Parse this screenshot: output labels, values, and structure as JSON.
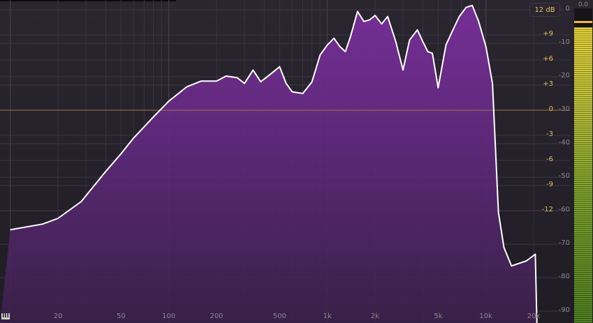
{
  "range_button": "12 dB",
  "meter": {
    "readout": "0.0",
    "level": 0.94,
    "peak": 0.96
  },
  "eq_scale": [
    "+9",
    "+6",
    "+3",
    "0",
    "-3",
    "-6",
    "-9",
    "-12"
  ],
  "db_scale": [
    "0",
    "-10",
    "-20",
    "-30",
    "-40",
    "-50",
    "-60",
    "-70",
    "-80",
    "-90"
  ],
  "freq_scale": [
    "20",
    "50",
    "100",
    "200",
    "500",
    "1k",
    "2k",
    "5k",
    "10k",
    "20k"
  ],
  "icons": {
    "piano": "piano-keys-icon"
  },
  "colors": {
    "curve": "#ffffff",
    "fill": "#6a2a88",
    "eq_text": "#e0c25a",
    "zero_line": "#b08a40"
  },
  "spectrum_db": [
    [
      10,
      -65.7
    ],
    [
      16,
      -64.0
    ],
    [
      20,
      -62.3
    ],
    [
      28,
      -57.3
    ],
    [
      40,
      -48.3
    ],
    [
      50,
      -43.0
    ],
    [
      60,
      -38.3
    ],
    [
      80,
      -32.0
    ],
    [
      100,
      -27.3
    ],
    [
      130,
      -23.0
    ],
    [
      160,
      -21.3
    ],
    [
      200,
      -21.3
    ],
    [
      230,
      -19.8
    ],
    [
      270,
      -20.3
    ],
    [
      300,
      -22.0
    ],
    [
      340,
      -18.0
    ],
    [
      380,
      -21.5
    ],
    [
      450,
      -18.8
    ],
    [
      500,
      -17.0
    ],
    [
      550,
      -22.0
    ],
    [
      600,
      -24.5
    ],
    [
      700,
      -25.0
    ],
    [
      800,
      -21.5
    ],
    [
      900,
      -13.5
    ],
    [
      1000,
      -10.5
    ],
    [
      1100,
      -8.5
    ],
    [
      1200,
      -11.0
    ],
    [
      1300,
      -12.5
    ],
    [
      1400,
      -8.0
    ],
    [
      1550,
      -0.5
    ],
    [
      1700,
      -3.5
    ],
    [
      1850,
      -3.0
    ],
    [
      2000,
      -1.7
    ],
    [
      2200,
      -4.2
    ],
    [
      2400,
      -2.0
    ],
    [
      2700,
      -9.5
    ],
    [
      3000,
      -18.0
    ],
    [
      3300,
      -9.0
    ],
    [
      3700,
      -6.0
    ],
    [
      4000,
      -9.5
    ],
    [
      4300,
      -12.5
    ],
    [
      4600,
      -13.0
    ],
    [
      5000,
      -23.3
    ],
    [
      5600,
      -10.5
    ],
    [
      6200,
      -6.0
    ],
    [
      6800,
      -2.0
    ],
    [
      7500,
      0.7
    ],
    [
      8200,
      1.3
    ],
    [
      9000,
      -3.5
    ],
    [
      10000,
      -11.0
    ],
    [
      11000,
      -22.0
    ],
    [
      12000,
      -60.5
    ],
    [
      13000,
      -71.0
    ],
    [
      14500,
      -76.5
    ],
    [
      18000,
      -75.0
    ],
    [
      20500,
      -73.0
    ],
    [
      21000,
      -95.0
    ]
  ]
}
